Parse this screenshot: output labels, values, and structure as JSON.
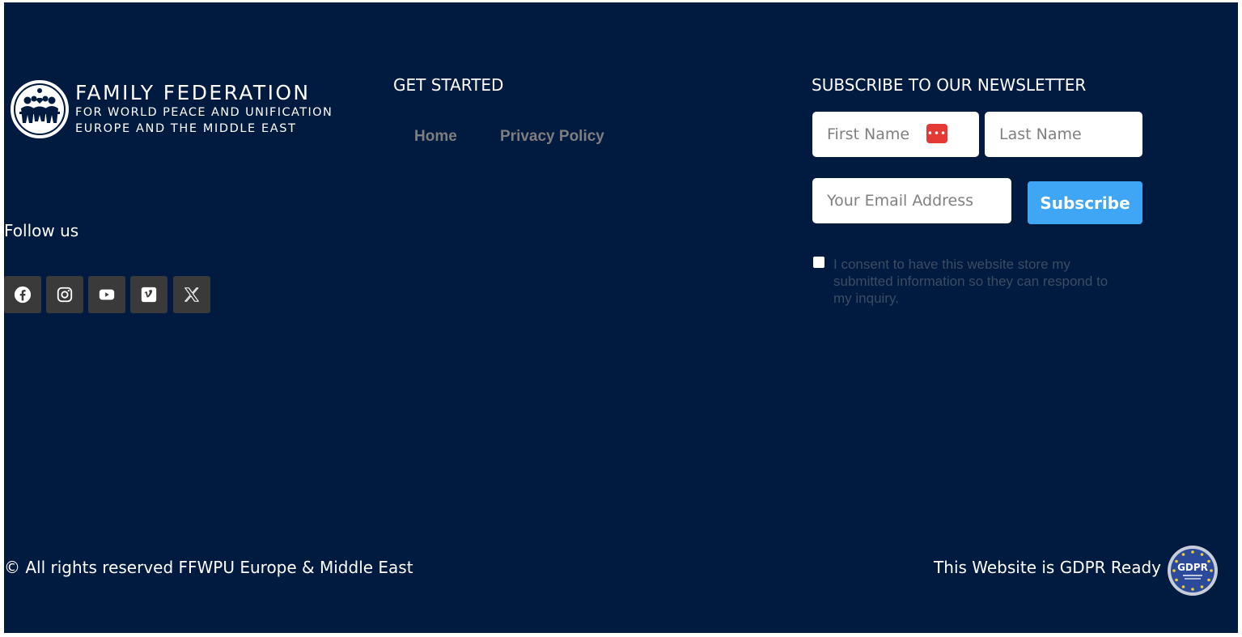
{
  "brand": {
    "line1": "FAMILY FEDERATION",
    "line2": "FOR WORLD PEACE AND UNIFICATION",
    "line3": "EUROPE AND THE MIDDLE EAST",
    "logo_icon": "ffwpu-emblem-icon"
  },
  "get_started": {
    "title": "GET STARTED",
    "links": [
      "Home",
      "Privacy Policy"
    ]
  },
  "follow": {
    "label": "Follow us",
    "icons": [
      "facebook-icon",
      "instagram-icon",
      "youtube-icon",
      "vimeo-icon",
      "x-icon"
    ]
  },
  "newsletter": {
    "title": "SUBSCRIBE TO OUR NEWSLETTER",
    "first_name_placeholder": "First Name",
    "last_name_placeholder": "Last Name",
    "email_placeholder": "Your Email Address",
    "subscribe_label": "Subscribe",
    "password_manager_icon": "password-manager-icon",
    "consent_text": "I consent to have this website store my submitted information so they can respond to my inquiry."
  },
  "footer": {
    "copyright": "© All rights reserved FFWPU Europe & Middle East",
    "gdpr_text": "This Website is GDPR Ready",
    "gdpr_badge_label": "GDPR"
  },
  "colors": {
    "background": "#001a40",
    "accent": "#3ea6f5",
    "social_tile": "#3a3a3a",
    "muted_link": "#7e7e7e"
  }
}
